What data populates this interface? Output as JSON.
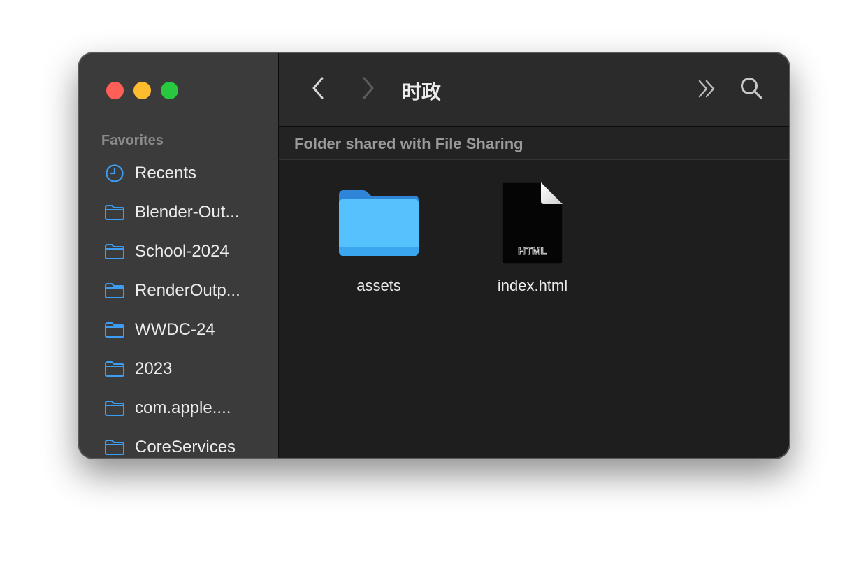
{
  "window": {
    "title": "时政"
  },
  "traffic_lights": [
    {
      "name": "close",
      "color": "#fe5f57"
    },
    {
      "name": "minimize",
      "color": "#febc2e"
    },
    {
      "name": "zoom",
      "color": "#28c840"
    }
  ],
  "sidebar": {
    "heading": "Favorites",
    "items": [
      {
        "label": "Recents",
        "icon": "clock-icon"
      },
      {
        "label": "Blender-Out...",
        "icon": "folder-icon"
      },
      {
        "label": "School-2024",
        "icon": "folder-icon"
      },
      {
        "label": "RenderOutp...",
        "icon": "folder-icon"
      },
      {
        "label": "WWDC-24",
        "icon": "folder-icon"
      },
      {
        "label": "2023",
        "icon": "folder-icon"
      },
      {
        "label": "com.apple....",
        "icon": "folder-icon"
      },
      {
        "label": "CoreServices",
        "icon": "folder-icon"
      }
    ]
  },
  "toolbar": {
    "back_icon": "chevron-left-icon",
    "forward_icon": "chevron-right-icon",
    "more_icon": "double-chevron-right-icon",
    "search_icon": "search-icon"
  },
  "path_bar": {
    "text": "Folder shared with File Sharing"
  },
  "files": [
    {
      "name": "assets",
      "kind": "folder",
      "icon": "folder-icon"
    },
    {
      "name": "index.html",
      "kind": "html",
      "icon": "html-file-icon",
      "badge": "HTML"
    }
  ],
  "colors": {
    "accent_folder": "#3c9df3",
    "sidebar_bg": "#3c3b3b",
    "main_bg": "#1e1e1e"
  }
}
